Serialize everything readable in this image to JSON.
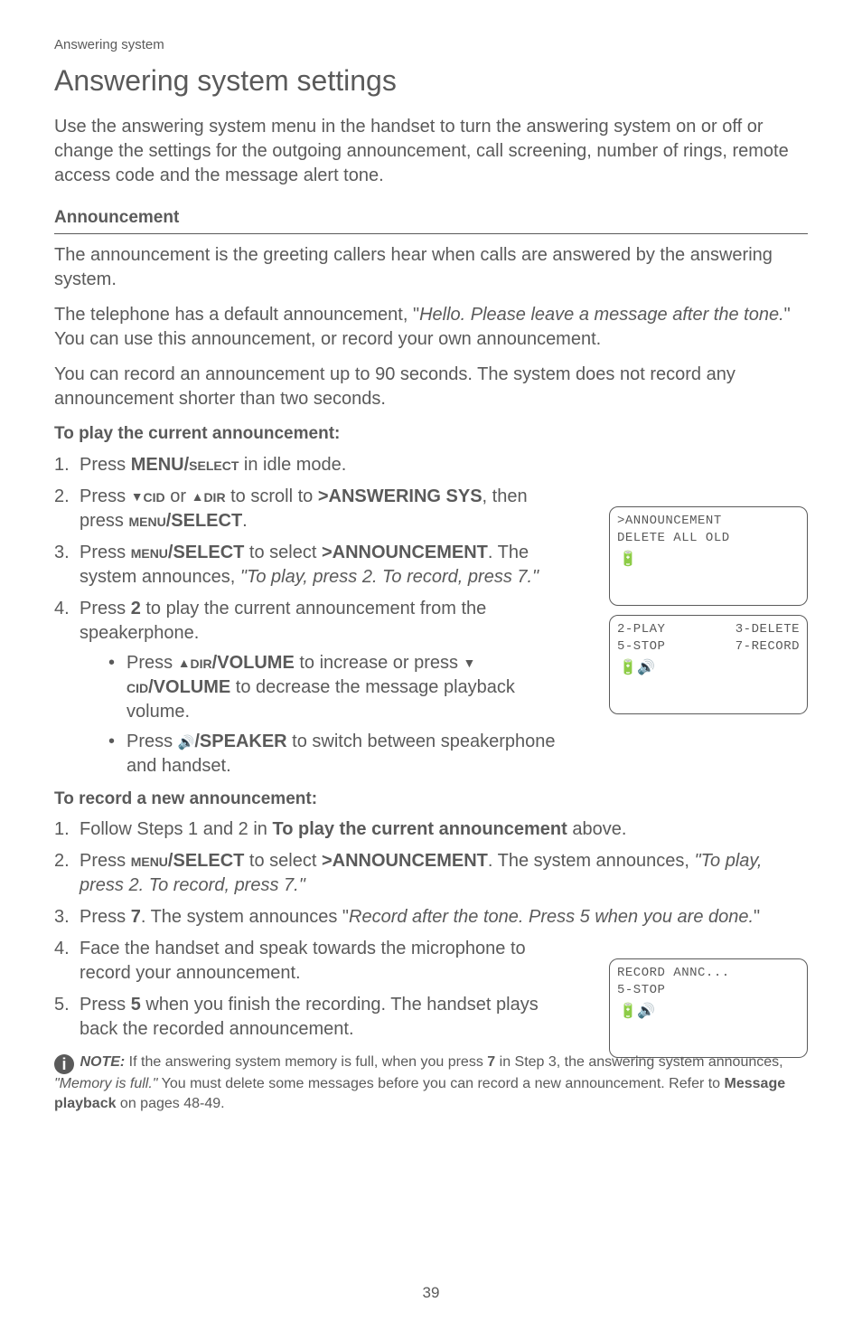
{
  "breadcrumb": "Answering system",
  "title": "Answering system settings",
  "intro": "Use the answering system menu in the handset to turn the answering system on or off or change the settings for the outgoing announcement, call screening, number of rings, remote access code and the message alert tone.",
  "section_head": "Announcement",
  "para1": "The announcement is the greeting callers hear when calls are answered by the answering system.",
  "para2a": "The telephone has a default announcement, \"",
  "para2b": "Hello. Please leave a message after the tone.",
  "para2c": "\" You can use this announcement, or record your own announcement.",
  "para3": "You can record an announcement up to 90 seconds. The system does not record any announcement shorter than two seconds.",
  "subhead1": "To play the current announcement:",
  "play": {
    "s1a": "Press ",
    "s1b": "MENU/",
    "s1c": "select",
    "s1d": " in idle mode.",
    "s2a": "Press ",
    "s2cid": "cid",
    "s2or": " or ",
    "s2dir": "dir",
    "s2b": " to scroll to ",
    "s2target": ">ANSWERING SYS",
    "s2c": ", then press ",
    "s2menu": "menu",
    "s2sel": "/SELECT",
    "s2d": ".",
    "s3a": "Press ",
    "s3menu": "menu",
    "s3sel": "/SELECT",
    "s3b": " to select ",
    "s3target": ">ANNOUNCEMENT",
    "s3c": ". The system announces, ",
    "s3quote": "\"To play, press 2. To record, press 7.\"",
    "s4a": "Press ",
    "s4key": "2",
    "s4b": " to play the current announcement from the speakerphone.",
    "b1a": "Press ",
    "b1dir": "dir",
    "b1vol": "/VOLUME",
    "b1b": " to increase or press ",
    "b1cid": "cid",
    "b1vol2": "/VOLUME",
    "b1c": " to decrease the message playback volume.",
    "b2a": "Press ",
    "b2spk": "/SPEAKER",
    "b2b": " to switch between speakerphone and handset."
  },
  "subhead2": "To record a new announcement:",
  "rec": {
    "s1a": "Follow Steps 1 and 2 in ",
    "s1b": "To play the current announcement",
    "s1c": " above.",
    "s2a": "Press ",
    "s2menu": "menu",
    "s2sel": "/SELECT",
    "s2b": " to select ",
    "s2target": ">ANNOUNCEMENT",
    "s2c": ". The system announces, ",
    "s2quote": "\"To play, press 2. To record, press 7.\"",
    "s3a": "Press ",
    "s3key": "7",
    "s3b": ". The system announces \"",
    "s3quote": "Record after the tone. Press 5 when you are done.",
    "s3c": "\"",
    "s4": "Face the handset and speak towards the microphone to record your announcement.",
    "s5a": "Press ",
    "s5key": "5",
    "s5b": " when you finish the recording. The handset plays back the recorded announcement."
  },
  "note": {
    "label": "NOTE:",
    "a": " If the answering system memory is full, when you press ",
    "key": "7",
    "b": " in Step 3, the answering system announces, ",
    "quote": "\"Memory is full.\"",
    "c": " You must delete some messages before you can record a new announcement. Refer to ",
    "ref": "Message playback",
    "d": " on pages 48-49."
  },
  "lcd1": {
    "l1": ">ANNOUNCEMENT",
    "l2": " DELETE ALL OLD",
    "batt": "🔋"
  },
  "lcd2": {
    "l1a": "2-PLAY",
    "l1b": "3-DELETE",
    "l2a": "5-STOP",
    "l2b": "7-RECORD",
    "batt": "🔋🔊"
  },
  "lcd3": {
    "l1": "RECORD ANNC...",
    "l2": "5-STOP",
    "batt": "🔋🔊"
  },
  "pagenum": "39"
}
